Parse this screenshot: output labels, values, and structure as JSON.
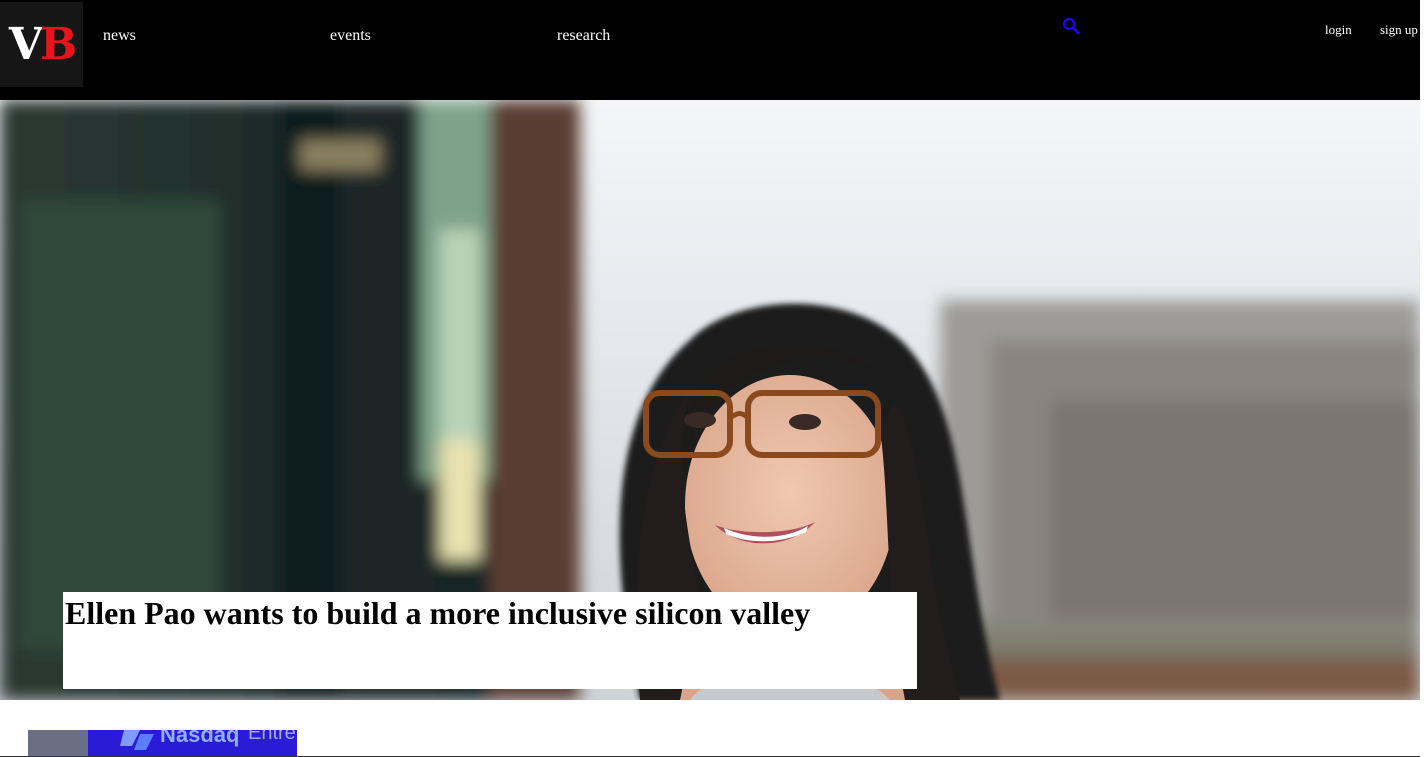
{
  "header": {
    "logo": {
      "letter_1": "V",
      "letter_2": "B",
      "icon": "vb-logo"
    },
    "nav": [
      {
        "label": "news"
      },
      {
        "label": "events"
      },
      {
        "label": "research"
      }
    ],
    "search": {
      "icon": "search-icon",
      "color": "#2200ff"
    },
    "auth": {
      "login_label": "login",
      "signup_label": "sign up"
    },
    "colors": {
      "background": "#000000",
      "logo_accent": "#e8141b"
    }
  },
  "hero": {
    "headline": "Ellen Pao wants to build a more inclusive silicon valley"
  },
  "thumbnail": {
    "brand_text": "Nasdaq",
    "sub_text": "Entre"
  }
}
